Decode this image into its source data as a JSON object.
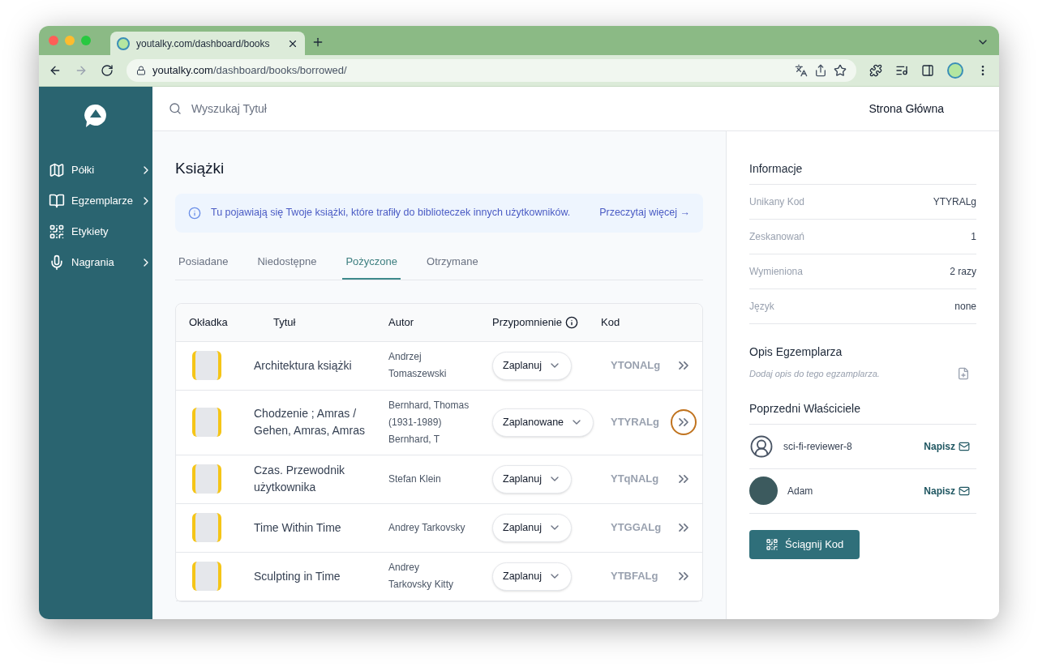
{
  "browser": {
    "tab_title": "youtalky.com/dashboard/books",
    "url_host": "youtalky.com",
    "url_path": "/dashboard/books/borrowed/"
  },
  "sidebar": {
    "items": [
      {
        "label": "Półki",
        "expandable": true
      },
      {
        "label": "Egzemplarze",
        "expandable": true
      },
      {
        "label": "Etykiety",
        "expandable": false
      },
      {
        "label": "Nagrania",
        "expandable": true
      }
    ]
  },
  "header": {
    "search_placeholder": "Wyszukaj Tytuł",
    "home_link": "Strona Główna"
  },
  "main": {
    "title": "Książki",
    "notice": {
      "text": "Tu pojawiają się Twoje książki, które trafiły do biblioteczek innych użytkowników.",
      "link": "Przeczytaj więcej →"
    },
    "tabs": [
      {
        "label": "Posiadane",
        "selected": false
      },
      {
        "label": "Niedostępne",
        "selected": false
      },
      {
        "label": "Pożyczone",
        "selected": true
      },
      {
        "label": "Otrzymane",
        "selected": false
      }
    ],
    "table": {
      "columns": [
        "Okładka",
        "Tytuł",
        "Autor",
        "Przypomnienie",
        "Kod"
      ],
      "rows": [
        {
          "title": "Architektura książki",
          "authors": [
            "Andrzej",
            "Tomaszewski"
          ],
          "reminder": "Zaplanuj",
          "code": "YTONALg",
          "selected": false
        },
        {
          "title": "Chodzenie ; Amras / Gehen, Amras, Amras",
          "authors": [
            "Bernhard, Thomas",
            "(1931-1989)",
            "Bernhard, T"
          ],
          "reminder": "Zaplanowane",
          "code": "YTYRALg",
          "selected": true
        },
        {
          "title": "Czas. Przewodnik użytkownika",
          "authors": [
            "Stefan Klein"
          ],
          "reminder": "Zaplanuj",
          "code": "YTqNALg",
          "selected": false
        },
        {
          "title": "Time Within Time",
          "authors": [
            "Andrey Tarkovsky"
          ],
          "reminder": "Zaplanuj",
          "code": "YTGGALg",
          "selected": false
        },
        {
          "title": "Sculpting in Time",
          "authors": [
            "Andrey",
            "Tarkovsky Kitty"
          ],
          "reminder": "Zaplanuj",
          "code": "YTBFALg",
          "selected": false
        }
      ]
    }
  },
  "panel": {
    "info_title": "Informacje",
    "info": [
      {
        "label": "Unikany Kod",
        "value": "YTYRALg"
      },
      {
        "label": "Zeskanowań",
        "value": "1"
      },
      {
        "label": "Wymieniona",
        "value": "2 razy"
      },
      {
        "label": "Język",
        "value": "none"
      }
    ],
    "description_title": "Opis Egzemplarza",
    "description_placeholder": "Dodaj opis do tego egzamplarza.",
    "owners_title": "Poprzedni Właściciele",
    "owners": [
      {
        "name": "sci-fi-reviewer-8",
        "kind": "icon",
        "action": "Napisz"
      },
      {
        "name": "Adam",
        "kind": "photo",
        "action": "Napisz"
      }
    ],
    "download_button": "Ściągnij Kod"
  }
}
